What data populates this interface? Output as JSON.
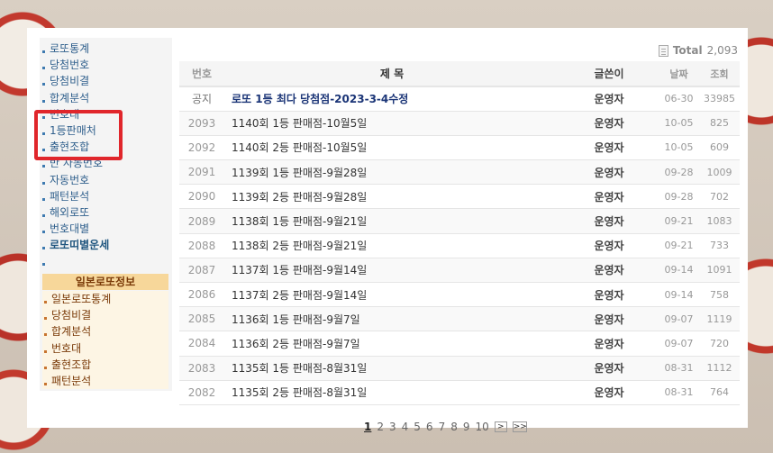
{
  "sidebar": {
    "items": [
      {
        "label": "로또통계",
        "bold": false
      },
      {
        "label": "당첨번호",
        "bold": false
      },
      {
        "label": "당첨비결",
        "bold": false
      },
      {
        "label": "합계분석",
        "bold": false
      },
      {
        "label": "번호대",
        "bold": false
      },
      {
        "label": "1등판매처",
        "bold": false
      },
      {
        "label": "출현조합",
        "bold": false
      },
      {
        "label": "반 자동번호",
        "bold": false
      },
      {
        "label": "자동번호",
        "bold": false
      },
      {
        "label": "패턴분석",
        "bold": false
      },
      {
        "label": "해외로또",
        "bold": false
      },
      {
        "label": "번호대별",
        "bold": false
      },
      {
        "label": "로또띠별운세",
        "bold": true
      },
      {
        "label": "",
        "bold": false
      }
    ],
    "japan_header": "일본로또정보",
    "japan_items": [
      "일본로또통계",
      "당첨비결",
      "합계분석",
      "번호대",
      "출현조합",
      "패턴분석"
    ]
  },
  "board": {
    "total_label": "Total",
    "total_count": "2,093",
    "columns": {
      "num": "번호",
      "title": "제    목",
      "writer": "글쓴이",
      "date": "날짜",
      "views": "조회"
    },
    "notice": {
      "num": "공지",
      "title": "로또 1등 최다 당첨점-2023-3-4수정",
      "writer": "운영자",
      "date": "06-30",
      "views": "33985"
    },
    "rows": [
      {
        "num": "2093",
        "title": "1140회 1등 판매점-10월5일",
        "writer": "운영자",
        "date": "10-05",
        "views": "825"
      },
      {
        "num": "2092",
        "title": "1140회 2등 판매점-10월5일",
        "writer": "운영자",
        "date": "10-05",
        "views": "609"
      },
      {
        "num": "2091",
        "title": "1139회 1등 판매점-9월28일",
        "writer": "운영자",
        "date": "09-28",
        "views": "1009"
      },
      {
        "num": "2090",
        "title": "1139회 2등 판매점-9월28일",
        "writer": "운영자",
        "date": "09-28",
        "views": "702"
      },
      {
        "num": "2089",
        "title": "1138회 1등 판매점-9월21일",
        "writer": "운영자",
        "date": "09-21",
        "views": "1083"
      },
      {
        "num": "2088",
        "title": "1138회 2등 판매점-9월21일",
        "writer": "운영자",
        "date": "09-21",
        "views": "733"
      },
      {
        "num": "2087",
        "title": "1137회 1등 판매점-9월14일",
        "writer": "운영자",
        "date": "09-14",
        "views": "1091"
      },
      {
        "num": "2086",
        "title": "1137회 2등 판매점-9월14일",
        "writer": "운영자",
        "date": "09-14",
        "views": "758"
      },
      {
        "num": "2085",
        "title": "1136회 1등 판매점-9월7일",
        "writer": "운영자",
        "date": "09-07",
        "views": "1119"
      },
      {
        "num": "2084",
        "title": "1136회 2등 판매점-9월7일",
        "writer": "운영자",
        "date": "09-07",
        "views": "720"
      },
      {
        "num": "2083",
        "title": "1135회 1등 판매점-8월31일",
        "writer": "운영자",
        "date": "08-31",
        "views": "1112"
      },
      {
        "num": "2082",
        "title": "1135회 2등 판매점-8월31일",
        "writer": "운영자",
        "date": "08-31",
        "views": "764"
      }
    ],
    "pagination": {
      "current": "1",
      "pages": [
        "2",
        "3",
        "4",
        "5",
        "6",
        "7",
        "8",
        "9",
        "10"
      ],
      "next": ">",
      "last": ">>"
    }
  }
}
